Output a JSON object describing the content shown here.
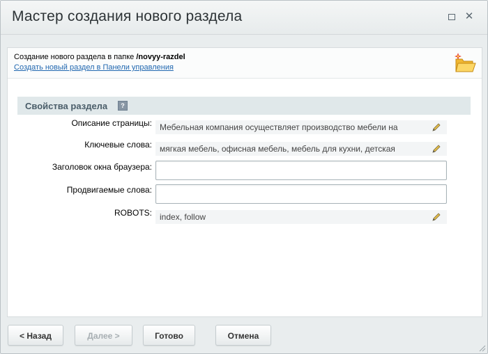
{
  "window": {
    "title": "Мастер создания нового раздела",
    "expand_icon": "expand-icon",
    "close_icon": "close-icon"
  },
  "header": {
    "text_prefix": "Создание нового раздела в папке ",
    "folder_path": "/novyy-razdel",
    "link": "Создать новый раздел в Панели управления",
    "icon": "folder-new-icon"
  },
  "section": {
    "title": "Свойства раздела",
    "help_icon": "help-icon",
    "help_glyph": "?"
  },
  "fields": {
    "description": {
      "label": "Описание страницы:",
      "value": "Мебельная компания осуществляет производство мебели на"
    },
    "keywords": {
      "label": "Ключевые слова:",
      "value": "мягкая мебель, офисная мебель, мебель для кухни, детская"
    },
    "browser_title": {
      "label": "Заголовок окна браузера:",
      "value": ""
    },
    "promoted_words": {
      "label": "Продвигаемые слова:",
      "value": ""
    },
    "robots": {
      "label": "ROBOTS:",
      "value": "index, follow"
    }
  },
  "buttons": {
    "back": "< Назад",
    "next": "Далее >",
    "done": "Готово",
    "cancel": "Отмена"
  },
  "colors": {
    "accent_link": "#2067b0",
    "section_bg": "#e0e8ea",
    "dialog_bg": "#e9edee"
  }
}
